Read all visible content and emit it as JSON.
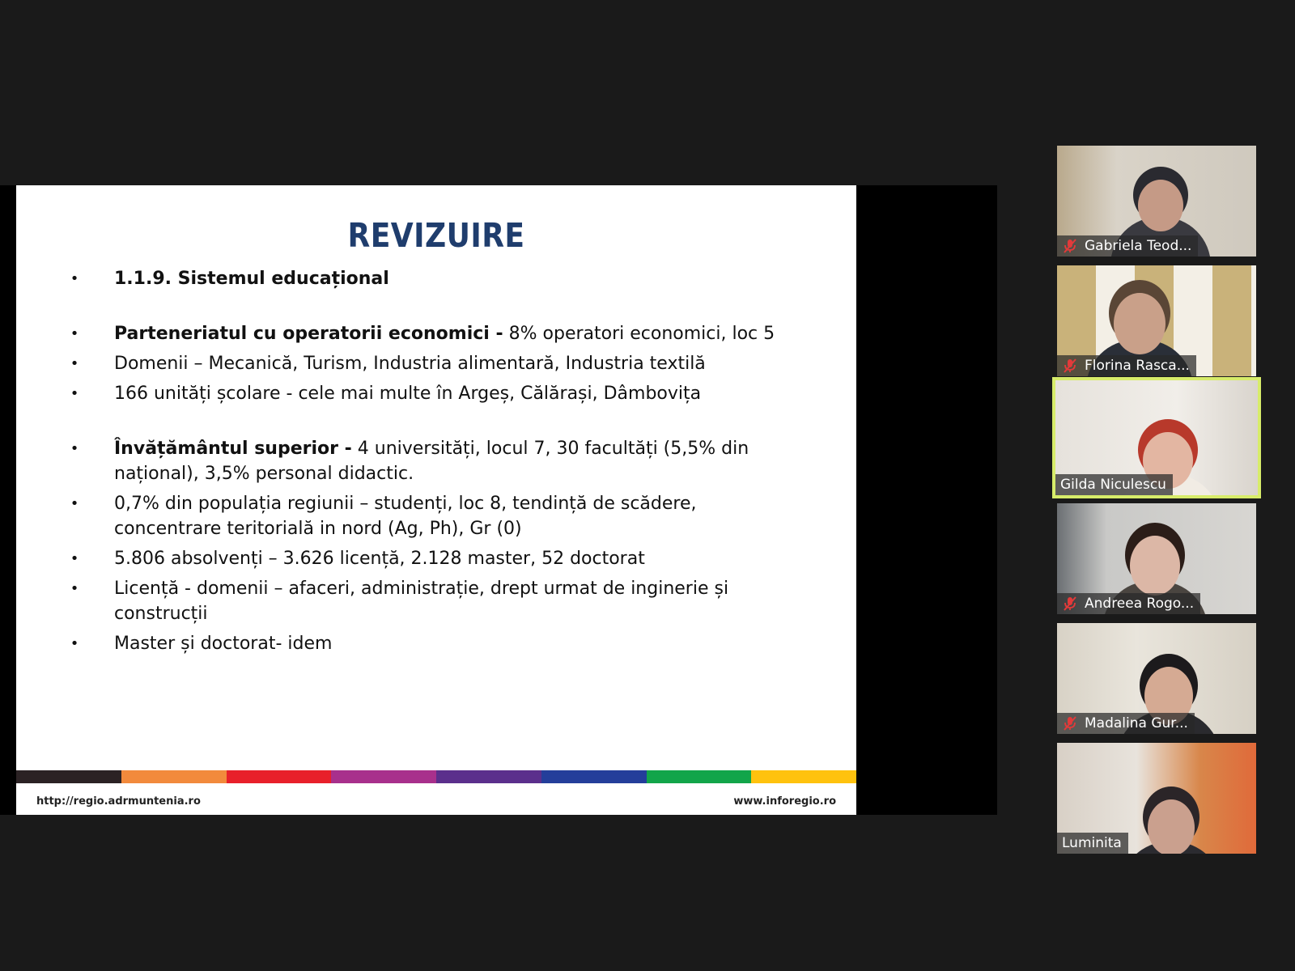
{
  "slide": {
    "title": "REVIZUIRE",
    "bullets": [
      {
        "bold": "1.1.9. Sistemul educațional",
        "text": "",
        "gap": false
      },
      {
        "bold": "Parteneriatul cu operatorii economici -",
        "text": " 8% operatori economici, loc 5",
        "gap": true
      },
      {
        "bold": "",
        "text": "Domenii – Mecanică, Turism, Industria alimentară, Industria textilă",
        "gap": false
      },
      {
        "bold": "",
        "text": "166 unități școlare - cele mai multe în Argeș, Călărași, Dâmbovița",
        "gap": false
      },
      {
        "bold": "Învățământul superior -",
        "text": " 4 universități, locul 7, 30 facultăți (5,5% din național), 3,5% personal didactic.",
        "gap": true
      },
      {
        "bold": "",
        "text": "0,7% din populația regiunii – studenți, loc 8, tendință de scădere, concentrare teritorială in nord (Ag, Ph), Gr (0)",
        "gap": false
      },
      {
        "bold": "",
        "text": "5.806 absolvenți – 3.626 licență, 2.128 master, 52 doctorat",
        "gap": false
      },
      {
        "bold": "",
        "text": "Licență - domenii – afaceri, administrație, drept urmat de inginerie și construcții",
        "gap": false
      },
      {
        "bold": "",
        "text": "Master și doctorat- idem",
        "gap": false
      }
    ],
    "color_bar": [
      "#2b2224",
      "#f28a3c",
      "#e8202a",
      "#a8308c",
      "#5b2f8c",
      "#243e9a",
      "#12a54a",
      "#ffc20e"
    ],
    "footer_left": "http://regio.adrmuntenia.ro",
    "footer_right": "www.inforegio.ro"
  },
  "participants": [
    {
      "name": "Gabriela Teod...",
      "muted": true,
      "active": false
    },
    {
      "name": "Florina Rasca...",
      "muted": true,
      "active": false
    },
    {
      "name": "Gilda Niculescu",
      "muted": false,
      "active": true
    },
    {
      "name": "Andreea Rogo...",
      "muted": true,
      "active": false
    },
    {
      "name": "Madalina Gur...",
      "muted": true,
      "active": false
    },
    {
      "name": "Luminita",
      "muted": false,
      "active": false
    }
  ]
}
